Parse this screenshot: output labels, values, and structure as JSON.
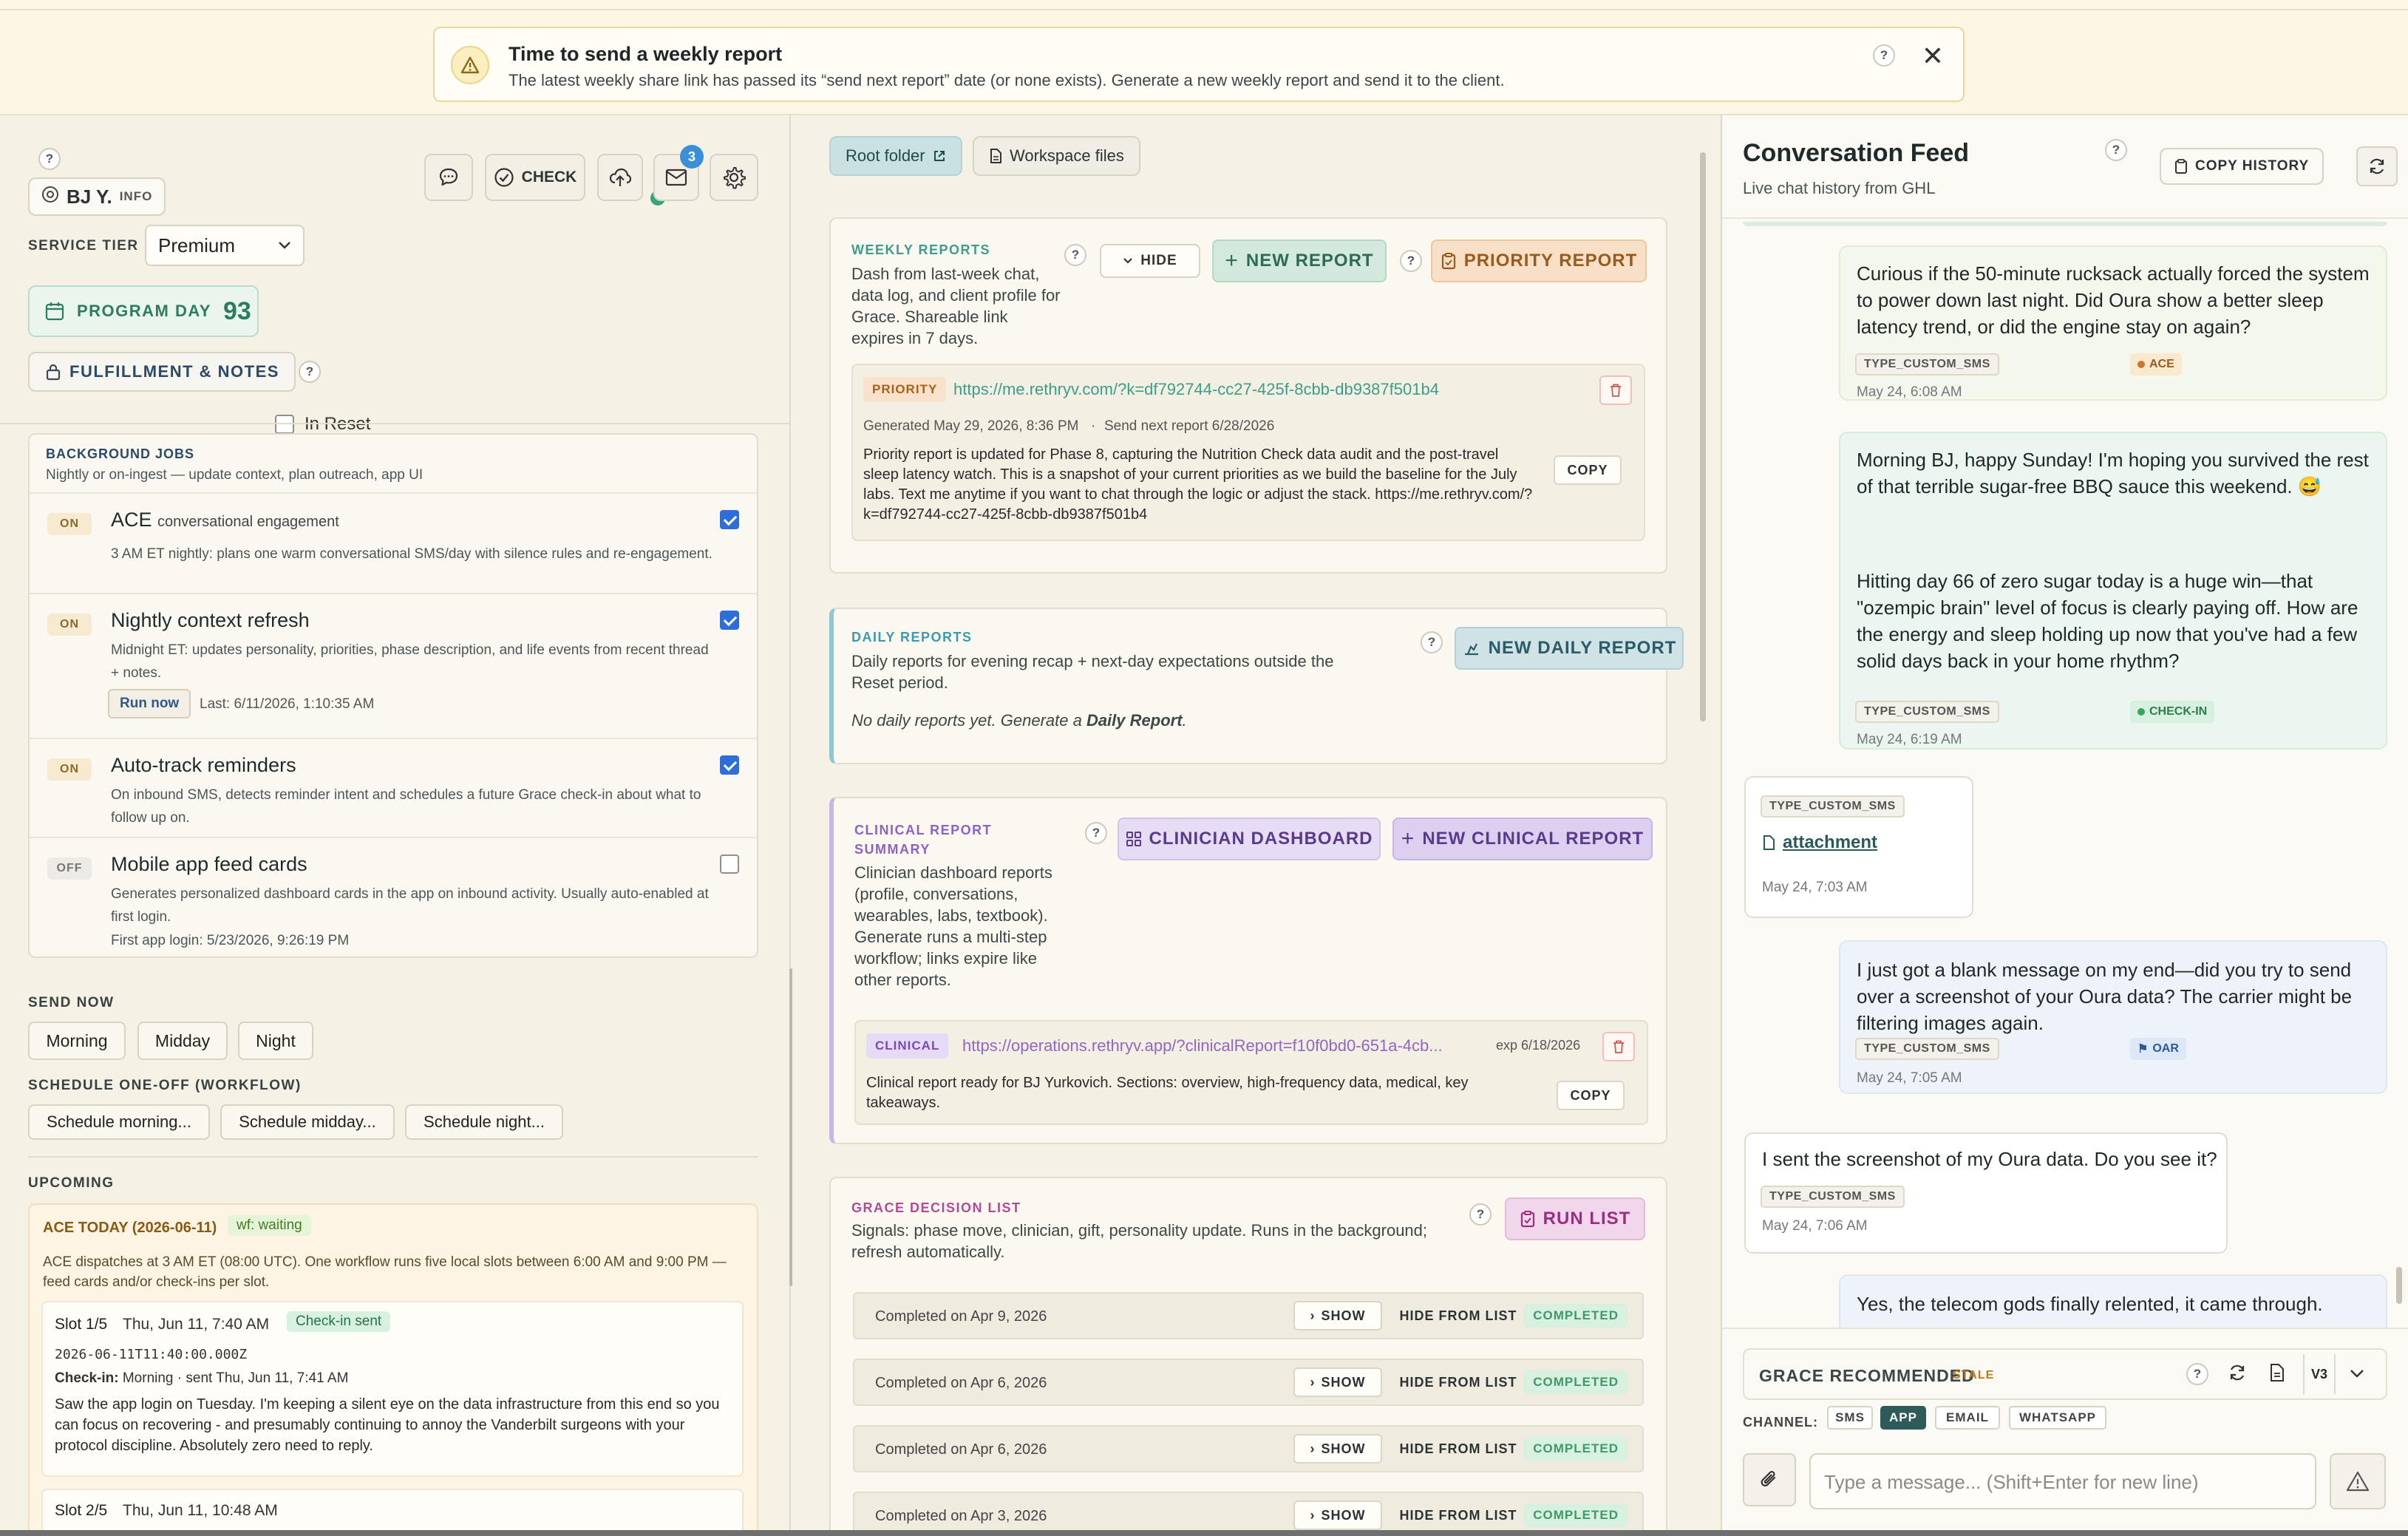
{
  "banner": {
    "title": "Time to send a weekly report",
    "message": "The latest weekly share link has passed its “send next report” date (or none exists). Generate a new weekly report and send it to the client."
  },
  "client": {
    "name": "BJ Y.",
    "info_label": "INFO",
    "service_tier_label": "SERVICE TIER",
    "service_tier_value": "Premium",
    "program_day_label": "PROGRAM DAY",
    "program_day_value": "93",
    "in_reset_label": "In Reset",
    "fulfillment_label": "FULFILLMENT & NOTES",
    "toolbar": {
      "check_label": "CHECK",
      "mail_badge": "3"
    }
  },
  "background_jobs": {
    "title": "BACKGROUND JOBS",
    "subtitle": "Nightly or on-ingest — update context, plan outreach, app UI",
    "jobs": [
      {
        "status": "ON",
        "name": "ACE",
        "name_suffix": "conversational engagement",
        "desc": "3 AM ET nightly: plans one warm conversational SMS/day with silence rules and re-engagement.",
        "checked": true
      },
      {
        "status": "ON",
        "name": "Nightly context refresh",
        "desc": "Midnight ET: updates personality, priorities, phase description, and life events from recent thread + notes.",
        "run_now": "Run now",
        "last": "Last: 6/11/2026, 1:10:35 AM",
        "checked": true
      },
      {
        "status": "ON",
        "name": "Auto-track reminders",
        "desc": "On inbound SMS, detects reminder intent and schedules a future Grace check-in about what to follow up on.",
        "checked": true
      },
      {
        "status": "OFF",
        "name": "Mobile app feed cards",
        "desc": "Generates personalized dashboard cards in the app on inbound activity. Usually auto-enabled at first login.",
        "extra": "First app login: 5/23/2026, 9:26:19 PM",
        "checked": false
      }
    ]
  },
  "send_now": {
    "label": "SEND NOW",
    "buttons": [
      "Morning",
      "Midday",
      "Night"
    ],
    "schedule_label": "SCHEDULE ONE-OFF (WORKFLOW)",
    "schedule_buttons": [
      "Schedule morning...",
      "Schedule midday...",
      "Schedule night..."
    ]
  },
  "upcoming": {
    "label": "UPCOMING",
    "ace_title": "ACE TODAY (2026-06-11)",
    "ace_status": "wf: waiting",
    "ace_desc": "ACE dispatches at 3 AM ET (08:00 UTC). One workflow runs five local slots between 6:00 AM and 9:00 PM — feed cards and/or check-ins per slot.",
    "slots": [
      {
        "title": "Slot 1/5",
        "time": "Thu, Jun 11, 7:40 AM",
        "status": "Check-in sent",
        "iso": "2026-06-11T11:40:00.000Z",
        "checkin_label": "Check-in:",
        "checkin_value": "Morning · sent Thu, Jun 11, 7:41 AM",
        "body": "Saw the app login on Tuesday. I'm keeping a silent eye on the data infrastructure from this end so you can focus on recovering - and presumably continuing to annoy the Vanderbilt surgeons with your protocol discipline. Absolutely zero need to reply."
      },
      {
        "title": "Slot 2/5",
        "time": "Thu, Jun 11, 10:48 AM"
      }
    ]
  },
  "files": {
    "root_folder": "Root folder",
    "workspace_files": "Workspace files"
  },
  "weekly_reports": {
    "title": "WEEKLY REPORTS",
    "desc": "Dash from last-week chat, data log, and client profile for Grace. Shareable link expires in 7 days.",
    "hide": "HIDE",
    "new_report": "NEW REPORT",
    "priority_report": "PRIORITY REPORT",
    "item": {
      "tag": "PRIORITY",
      "url": "https://me.rethryv.com/?k=df792744-cc27-425f-8cbb-db9387f501b4",
      "generated": "Generated May 29, 2026, 8:36 PM",
      "next": "Send next report 6/28/2026",
      "body": "Priority report is updated for Phase 8, capturing the Nutrition Check data audit and the post-travel sleep latency watch. This is a snapshot of your current priorities as we build the baseline for the July labs. Text me anytime if you want to chat through the logic or adjust the stack. https://me.rethryv.com/?k=df792744-cc27-425f-8cbb-db9387f501b4",
      "copy": "COPY"
    }
  },
  "daily_reports": {
    "title": "DAILY REPORTS",
    "desc": "Daily reports for evening recap + next-day expectations outside the Reset period.",
    "empty_prefix": "No daily reports yet. Generate a ",
    "empty_link": "Daily Report",
    "empty_suffix": ".",
    "new_daily": "NEW DAILY REPORT"
  },
  "clinical": {
    "title": "CLINICAL REPORT SUMMARY",
    "desc": "Clinician dashboard reports (profile, conversations, wearables, labs, textbook). Generate runs a multi-step workflow; links expire like other reports.",
    "dashboard": "CLINICIAN DASHBOARD",
    "new_clinical": "NEW CLINICAL REPORT",
    "item": {
      "tag": "CLINICAL",
      "url": "https://operations.rethryv.app/?clinicalReport=f10f0bd0-651a-4cb...",
      "exp": "exp 6/18/2026",
      "body": "Clinical report ready for BJ Yurkovich. Sections: overview, high-frequency data, medical, key takeaways.",
      "copy": "COPY"
    }
  },
  "decision_list": {
    "title": "GRACE DECISION LIST",
    "desc": "Signals: phase move, clinician, gift, personality update. Runs in the background; refresh automatically.",
    "run": "RUN LIST",
    "show": "SHOW",
    "hide_from_list": "HIDE FROM LIST",
    "completed": "COMPLETED",
    "rows": [
      "Completed on Apr 9, 2026",
      "Completed on Apr 6, 2026",
      "Completed on Apr 6, 2026",
      "Completed on Apr 3, 2026"
    ]
  },
  "feed": {
    "title": "Conversation Feed",
    "subtitle": "Live chat history from GHL",
    "copy_history": "COPY HISTORY",
    "messages": [
      {
        "text": "Curious if the 50-minute rucksack actually forced the system to power down last night. Did Oura show a better sleep latency trend, or did the engine stay on again?",
        "chip1": "TYPE_CUSTOM_SMS",
        "chip2": "ACE",
        "time": "May 24, 6:08 AM"
      },
      {
        "text": "Morning BJ, happy Sunday! I'm hoping you survived the rest of that terrible sugar-free BBQ sauce this weekend. 😅",
        "text2": "Hitting day 66 of zero sugar today is a huge win—that \"ozempic brain\" level of focus is clearly paying off. How are the energy and sleep holding up now that you've had a few solid days back in your home rhythm?",
        "chip1": "TYPE_CUSTOM_SMS",
        "chip2": "CHECK-IN",
        "time": "May 24, 6:19 AM"
      },
      {
        "chip1": "TYPE_CUSTOM_SMS",
        "attachment": "attachment",
        "time": "May 24, 7:03 AM"
      },
      {
        "text": "I just got a blank message on my end—did you try to send over a screenshot of your Oura data? The carrier might be filtering images again.",
        "chip1": "TYPE_CUSTOM_SMS",
        "chip2": "OAR",
        "time": "May 24, 7:05 AM"
      },
      {
        "text": "I sent the screenshot of my Oura data. Do you see it?",
        "chip1": "TYPE_CUSTOM_SMS",
        "time": "May 24, 7:06 AM"
      },
      {
        "text": "Yes, the telecom gods finally relented, it came through."
      }
    ],
    "composer": {
      "recommended": "GRACE RECOMMENDED",
      "stale": "STALE",
      "version": "V3",
      "channel_label": "CHANNEL:",
      "channels": [
        "SMS",
        "APP",
        "EMAIL",
        "WHATSAPP"
      ],
      "active_channel": "APP",
      "placeholder": "Type a message... (Shift+Enter for new line)"
    }
  }
}
